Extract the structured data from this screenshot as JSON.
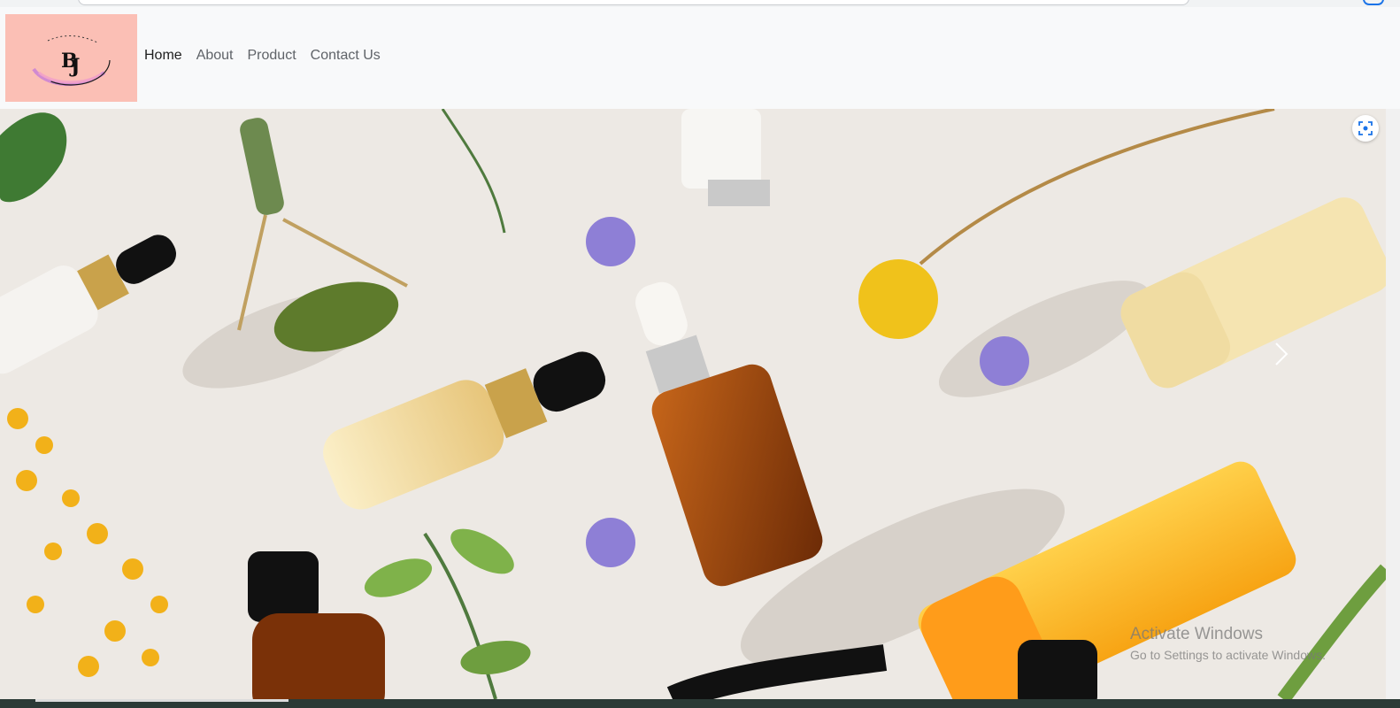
{
  "nav": {
    "logo_alt": "BJ logo",
    "links": [
      {
        "label": "Home",
        "active": true
      },
      {
        "label": "About",
        "active": false
      },
      {
        "label": "Product",
        "active": false
      },
      {
        "label": "Contact Us",
        "active": false
      }
    ]
  },
  "hero": {
    "image_description": "Flat lay of skincare products: serum dropper bottles, jade roller, cream tubes, flowers and leaves",
    "next_icon": "chevron-right-icon",
    "lens_icon": "visual-search-icon"
  },
  "watermark": {
    "title": "Activate Windows",
    "subtitle": "Go to Settings to activate Windows."
  },
  "colors": {
    "logo_bg": "#fbbfb5",
    "nav_bg": "#f8f9fa",
    "hero_bg": "#ede9e4"
  }
}
